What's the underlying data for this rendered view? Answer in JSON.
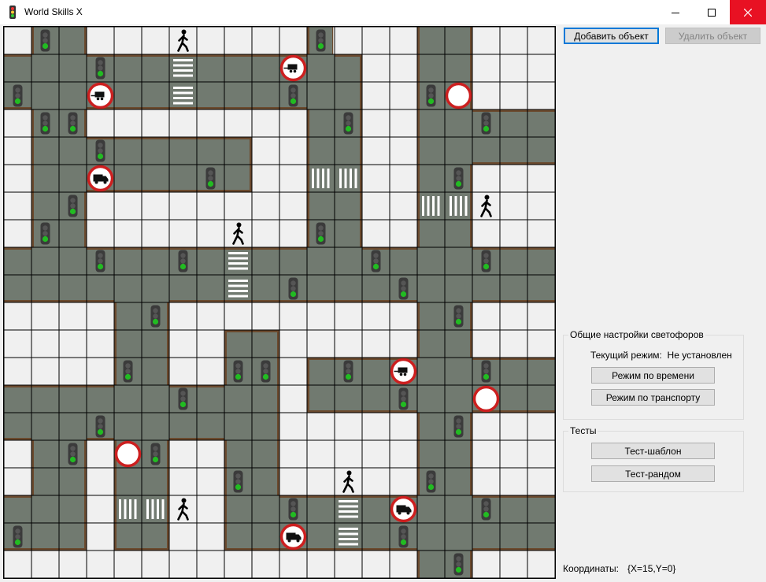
{
  "window": {
    "title": "World Skills X",
    "icon": "traffic-light-icon",
    "controls": [
      "minimize-icon",
      "maximize-icon",
      "close-icon"
    ]
  },
  "toolbar": {
    "add_label": "Добавить объект",
    "delete_label": "Удалить объект"
  },
  "traffic_settings": {
    "title": "Общие настройки светофоров",
    "mode_label": "Текущий режим:",
    "mode_value": "Не установлен",
    "time_mode_label": "Режим по времени",
    "transport_mode_label": "Режим по транспорту"
  },
  "tests": {
    "title": "Тесты",
    "template_label": "Тест-шаблон",
    "random_label": "Тест-рандом"
  },
  "status": {
    "coords_label": "Координаты:",
    "coords_value": "{X=15,Y=0}"
  },
  "colors": {
    "road": "#717a70",
    "curb": "#6b4a2e",
    "sign_red": "#cc1f1f",
    "light_green": "#22bb22",
    "close_red": "#e81123",
    "focus_blue": "#0078d7"
  },
  "map": {
    "cols": 20,
    "rows": 20,
    "roads": [
      [
        1,
        0
      ],
      [
        2,
        0
      ],
      [
        11,
        0
      ],
      [
        15,
        0
      ],
      [
        16,
        0
      ],
      [
        0,
        1
      ],
      [
        1,
        1
      ],
      [
        2,
        1
      ],
      [
        3,
        1
      ],
      [
        4,
        1
      ],
      [
        5,
        1
      ],
      [
        6,
        1
      ],
      [
        7,
        1
      ],
      [
        8,
        1
      ],
      [
        9,
        1
      ],
      [
        10,
        1
      ],
      [
        11,
        1
      ],
      [
        12,
        1
      ],
      [
        15,
        1
      ],
      [
        16,
        1
      ],
      [
        0,
        2
      ],
      [
        1,
        2
      ],
      [
        2,
        2
      ],
      [
        3,
        2
      ],
      [
        4,
        2
      ],
      [
        5,
        2
      ],
      [
        6,
        2
      ],
      [
        7,
        2
      ],
      [
        8,
        2
      ],
      [
        9,
        2
      ],
      [
        10,
        2
      ],
      [
        11,
        2
      ],
      [
        12,
        2
      ],
      [
        15,
        2
      ],
      [
        16,
        2
      ],
      [
        1,
        3
      ],
      [
        2,
        3
      ],
      [
        11,
        3
      ],
      [
        12,
        3
      ],
      [
        15,
        3
      ],
      [
        16,
        3
      ],
      [
        17,
        3
      ],
      [
        18,
        3
      ],
      [
        19,
        3
      ],
      [
        1,
        4
      ],
      [
        2,
        4
      ],
      [
        3,
        4
      ],
      [
        4,
        4
      ],
      [
        5,
        4
      ],
      [
        6,
        4
      ],
      [
        7,
        4
      ],
      [
        8,
        4
      ],
      [
        11,
        4
      ],
      [
        12,
        4
      ],
      [
        15,
        4
      ],
      [
        16,
        4
      ],
      [
        17,
        4
      ],
      [
        18,
        4
      ],
      [
        19,
        4
      ],
      [
        1,
        5
      ],
      [
        2,
        5
      ],
      [
        3,
        5
      ],
      [
        4,
        5
      ],
      [
        5,
        5
      ],
      [
        6,
        5
      ],
      [
        7,
        5
      ],
      [
        8,
        5
      ],
      [
        11,
        5
      ],
      [
        12,
        5
      ],
      [
        15,
        5
      ],
      [
        16,
        5
      ],
      [
        1,
        6
      ],
      [
        2,
        6
      ],
      [
        11,
        6
      ],
      [
        12,
        6
      ],
      [
        15,
        6
      ],
      [
        16,
        6
      ],
      [
        1,
        7
      ],
      [
        2,
        7
      ],
      [
        11,
        7
      ],
      [
        12,
        7
      ],
      [
        15,
        7
      ],
      [
        16,
        7
      ],
      [
        0,
        8
      ],
      [
        1,
        8
      ],
      [
        2,
        8
      ],
      [
        3,
        8
      ],
      [
        4,
        8
      ],
      [
        5,
        8
      ],
      [
        6,
        8
      ],
      [
        7,
        8
      ],
      [
        8,
        8
      ],
      [
        9,
        8
      ],
      [
        10,
        8
      ],
      [
        11,
        8
      ],
      [
        12,
        8
      ],
      [
        13,
        8
      ],
      [
        14,
        8
      ],
      [
        15,
        8
      ],
      [
        16,
        8
      ],
      [
        17,
        8
      ],
      [
        18,
        8
      ],
      [
        19,
        8
      ],
      [
        0,
        9
      ],
      [
        1,
        9
      ],
      [
        2,
        9
      ],
      [
        3,
        9
      ],
      [
        4,
        9
      ],
      [
        5,
        9
      ],
      [
        6,
        9
      ],
      [
        7,
        9
      ],
      [
        8,
        9
      ],
      [
        9,
        9
      ],
      [
        10,
        9
      ],
      [
        11,
        9
      ],
      [
        12,
        9
      ],
      [
        13,
        9
      ],
      [
        14,
        9
      ],
      [
        15,
        9
      ],
      [
        16,
        9
      ],
      [
        17,
        9
      ],
      [
        18,
        9
      ],
      [
        19,
        9
      ],
      [
        4,
        10
      ],
      [
        5,
        10
      ],
      [
        15,
        10
      ],
      [
        16,
        10
      ],
      [
        4,
        11
      ],
      [
        5,
        11
      ],
      [
        8,
        11
      ],
      [
        9,
        11
      ],
      [
        15,
        11
      ],
      [
        16,
        11
      ],
      [
        4,
        12
      ],
      [
        5,
        12
      ],
      [
        8,
        12
      ],
      [
        9,
        12
      ],
      [
        11,
        12
      ],
      [
        12,
        12
      ],
      [
        13,
        12
      ],
      [
        14,
        12
      ],
      [
        15,
        12
      ],
      [
        16,
        12
      ],
      [
        17,
        12
      ],
      [
        18,
        12
      ],
      [
        19,
        12
      ],
      [
        0,
        13
      ],
      [
        1,
        13
      ],
      [
        2,
        13
      ],
      [
        3,
        13
      ],
      [
        4,
        13
      ],
      [
        5,
        13
      ],
      [
        6,
        13
      ],
      [
        7,
        13
      ],
      [
        8,
        13
      ],
      [
        9,
        13
      ],
      [
        11,
        13
      ],
      [
        12,
        13
      ],
      [
        13,
        13
      ],
      [
        14,
        13
      ],
      [
        15,
        13
      ],
      [
        16,
        13
      ],
      [
        17,
        13
      ],
      [
        18,
        13
      ],
      [
        19,
        13
      ],
      [
        0,
        14
      ],
      [
        1,
        14
      ],
      [
        2,
        14
      ],
      [
        3,
        14
      ],
      [
        4,
        14
      ],
      [
        5,
        14
      ],
      [
        6,
        14
      ],
      [
        7,
        14
      ],
      [
        8,
        14
      ],
      [
        9,
        14
      ],
      [
        15,
        14
      ],
      [
        16,
        14
      ],
      [
        1,
        15
      ],
      [
        2,
        15
      ],
      [
        4,
        15
      ],
      [
        5,
        15
      ],
      [
        8,
        15
      ],
      [
        9,
        15
      ],
      [
        15,
        15
      ],
      [
        16,
        15
      ],
      [
        1,
        16
      ],
      [
        2,
        16
      ],
      [
        4,
        16
      ],
      [
        5,
        16
      ],
      [
        8,
        16
      ],
      [
        9,
        16
      ],
      [
        15,
        16
      ],
      [
        16,
        16
      ],
      [
        0,
        17
      ],
      [
        1,
        17
      ],
      [
        2,
        17
      ],
      [
        4,
        17
      ],
      [
        5,
        17
      ],
      [
        8,
        17
      ],
      [
        9,
        17
      ],
      [
        10,
        17
      ],
      [
        11,
        17
      ],
      [
        12,
        17
      ],
      [
        13,
        17
      ],
      [
        14,
        17
      ],
      [
        15,
        17
      ],
      [
        16,
        17
      ],
      [
        17,
        17
      ],
      [
        18,
        17
      ],
      [
        19,
        17
      ],
      [
        0,
        18
      ],
      [
        1,
        18
      ],
      [
        2,
        18
      ],
      [
        4,
        18
      ],
      [
        5,
        18
      ],
      [
        8,
        18
      ],
      [
        9,
        18
      ],
      [
        10,
        18
      ],
      [
        11,
        18
      ],
      [
        12,
        18
      ],
      [
        13,
        18
      ],
      [
        14,
        18
      ],
      [
        15,
        18
      ],
      [
        16,
        18
      ],
      [
        17,
        18
      ],
      [
        18,
        18
      ],
      [
        19,
        18
      ],
      [
        15,
        19
      ],
      [
        16,
        19
      ]
    ],
    "traffic_lights": [
      [
        1,
        0
      ],
      [
        11,
        0
      ],
      [
        3,
        1
      ],
      [
        0,
        2
      ],
      [
        10,
        2
      ],
      [
        15,
        2
      ],
      [
        1,
        3
      ],
      [
        2,
        3
      ],
      [
        12,
        3
      ],
      [
        17,
        3
      ],
      [
        3,
        4
      ],
      [
        7,
        5
      ],
      [
        16,
        5
      ],
      [
        2,
        6
      ],
      [
        1,
        7
      ],
      [
        11,
        7
      ],
      [
        3,
        8
      ],
      [
        6,
        8
      ],
      [
        13,
        8
      ],
      [
        17,
        8
      ],
      [
        10,
        9
      ],
      [
        14,
        9
      ],
      [
        5,
        10
      ],
      [
        16,
        10
      ],
      [
        4,
        12
      ],
      [
        8,
        12
      ],
      [
        9,
        12
      ],
      [
        12,
        12
      ],
      [
        17,
        12
      ],
      [
        6,
        13
      ],
      [
        14,
        13
      ],
      [
        3,
        14
      ],
      [
        16,
        14
      ],
      [
        2,
        15
      ],
      [
        5,
        15
      ],
      [
        8,
        16
      ],
      [
        15,
        16
      ],
      [
        10,
        17
      ],
      [
        17,
        17
      ],
      [
        0,
        18
      ],
      [
        14,
        18
      ],
      [
        16,
        19
      ]
    ],
    "pedestrians": [
      [
        6,
        0
      ],
      [
        17,
        6
      ],
      [
        8,
        7
      ],
      [
        12,
        16
      ],
      [
        6,
        17
      ]
    ],
    "crosswalks": [
      {
        "cell": [
          6,
          1
        ],
        "dir": "h"
      },
      {
        "cell": [
          6,
          2
        ],
        "dir": "h"
      },
      {
        "cell": [
          11,
          5
        ],
        "dir": "v"
      },
      {
        "cell": [
          12,
          5
        ],
        "dir": "v"
      },
      {
        "cell": [
          15,
          6
        ],
        "dir": "v"
      },
      {
        "cell": [
          16,
          6
        ],
        "dir": "v"
      },
      {
        "cell": [
          8,
          8
        ],
        "dir": "h"
      },
      {
        "cell": [
          8,
          9
        ],
        "dir": "h"
      },
      {
        "cell": [
          4,
          17
        ],
        "dir": "v"
      },
      {
        "cell": [
          5,
          17
        ],
        "dir": "v"
      },
      {
        "cell": [
          12,
          17
        ],
        "dir": "h"
      },
      {
        "cell": [
          12,
          18
        ],
        "dir": "h"
      }
    ],
    "signs": [
      {
        "cell": [
          10,
          1
        ],
        "type": "no-trailer"
      },
      {
        "cell": [
          3,
          2
        ],
        "type": "no-trailer"
      },
      {
        "cell": [
          16,
          2
        ],
        "type": "no-entry"
      },
      {
        "cell": [
          3,
          5
        ],
        "type": "no-trucks"
      },
      {
        "cell": [
          14,
          12
        ],
        "type": "no-trailer"
      },
      {
        "cell": [
          17,
          13
        ],
        "type": "no-entry"
      },
      {
        "cell": [
          4,
          15
        ],
        "type": "no-entry"
      },
      {
        "cell": [
          14,
          17
        ],
        "type": "no-trucks"
      },
      {
        "cell": [
          10,
          18
        ],
        "type": "no-trucks"
      }
    ]
  }
}
